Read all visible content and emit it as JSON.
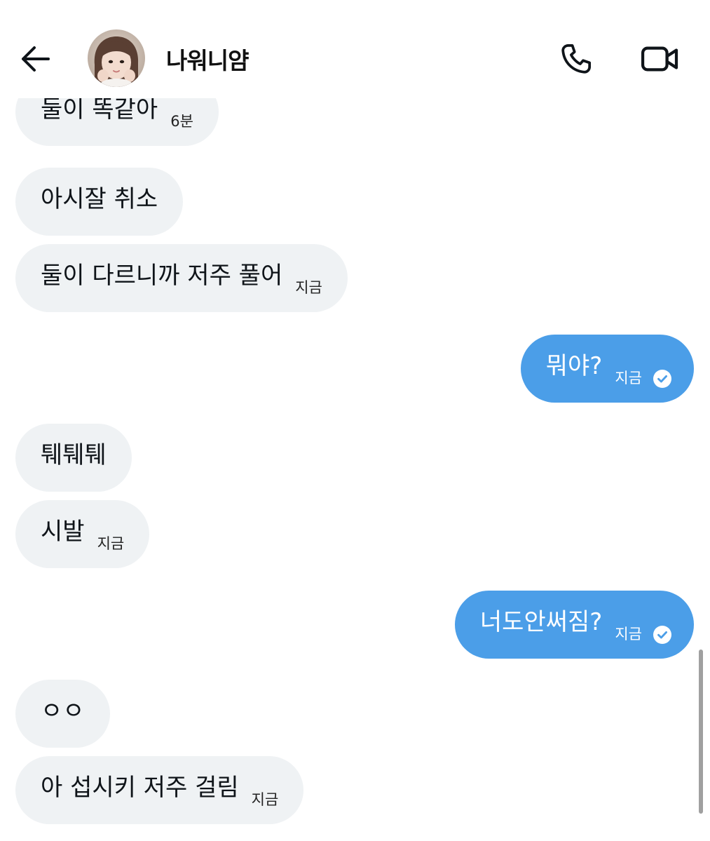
{
  "header": {
    "contact_name": "나워니얌",
    "icons": {
      "back": "arrow-left-icon",
      "phone": "phone-icon",
      "video": "video-camera-icon"
    }
  },
  "messages": [
    {
      "direction": "incoming",
      "text": "둘이 똑같아",
      "time": "6분"
    },
    {
      "direction": "incoming",
      "text": "아시잘 취소",
      "time": ""
    },
    {
      "direction": "incoming",
      "text": "둘이 다르니까 저주 풀어",
      "time": "지금"
    },
    {
      "direction": "outgoing",
      "text": "뭐야?",
      "time": "지금",
      "read": true
    },
    {
      "direction": "incoming",
      "text": "퉤퉤퉤",
      "time": ""
    },
    {
      "direction": "incoming",
      "text": "시발",
      "time": "지금"
    },
    {
      "direction": "outgoing",
      "text": "너도안써짐?",
      "time": "지금",
      "read": true
    },
    {
      "direction": "incoming",
      "text": "ㅇㅇ",
      "time": ""
    },
    {
      "direction": "incoming",
      "text": "아 섭시키 저주 걸림",
      "time": "지금"
    }
  ],
  "colors": {
    "incoming_bubble": "#eff2f4",
    "outgoing_bubble": "#4b9ee8",
    "text": "#0f1419"
  }
}
